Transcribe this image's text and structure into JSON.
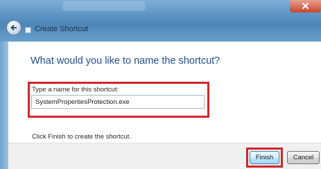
{
  "window": {
    "title": "Create Shortcut",
    "icons": [
      "back-arrow-icon",
      "shortcut-icon",
      "close-icon"
    ]
  },
  "main": {
    "heading": "What would you like to name the shortcut?",
    "name_field": {
      "label": "Type a name for this shortcut:",
      "value": "SystemPropertiesProtection.exe"
    },
    "hint": "Click Finish to create the shortcut."
  },
  "footer": {
    "finish_label": "Finish",
    "cancel_label": "Cancel"
  },
  "colors": {
    "heading": "#1f4e8c",
    "highlight": "#d4242c",
    "titlebar": "#5d95c5"
  }
}
